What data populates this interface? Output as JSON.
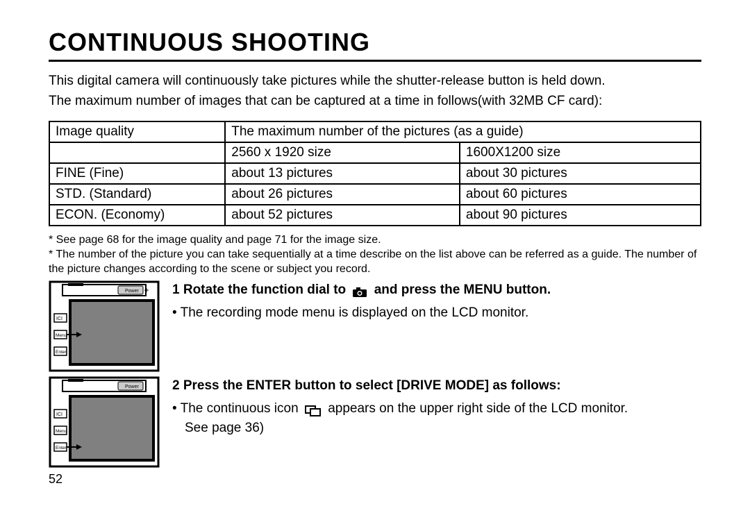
{
  "title": "CONTINUOUS SHOOTING",
  "intro_line1": "This digital camera will continuously take pictures while the shutter-release button is held down.",
  "intro_line2": "The maximum number of images that can be captured at a time in follows(with 32MB CF card):",
  "table": {
    "header_left": "Image quality",
    "header_right": "The maximum number of the pictures (as a guide)",
    "subhead_a": "2560 x 1920 size",
    "subhead_b": "1600X1200 size",
    "rows": [
      {
        "label": "FINE (Fine)",
        "a": "about 13 pictures",
        "b": "about 30 pictures"
      },
      {
        "label": "STD. (Standard)",
        "a": "about 26 pictures",
        "b": "about 60 pictures"
      },
      {
        "label": "ECON. (Economy)",
        "a": "about 52 pictures",
        "b": "about 90 pictures"
      }
    ]
  },
  "notes": {
    "line1": "* See page 68 for the image quality and page 71 for the image size.",
    "line2": "* The number of the picture you can take sequentially at a time describe on the list above can be referred as a guide. The number of the picture changes according to the scene or subject you record."
  },
  "step1": {
    "head_a": "1  Rotate the function dial to",
    "head_b": "and press the MENU button.",
    "body": "• The recording mode menu is displayed on the LCD monitor."
  },
  "step2": {
    "head": "2  Press the ENTER button to select [DRIVE MODE] as follows:",
    "body_a": "• The continuous icon",
    "body_b": "appears on the upper right side of the LCD monitor.",
    "body_c": "See page 36)"
  },
  "illus_labels": {
    "power": "Power",
    "menu": "Menu",
    "enter": "Enter",
    "ici": "ICI"
  },
  "page_number": "52"
}
